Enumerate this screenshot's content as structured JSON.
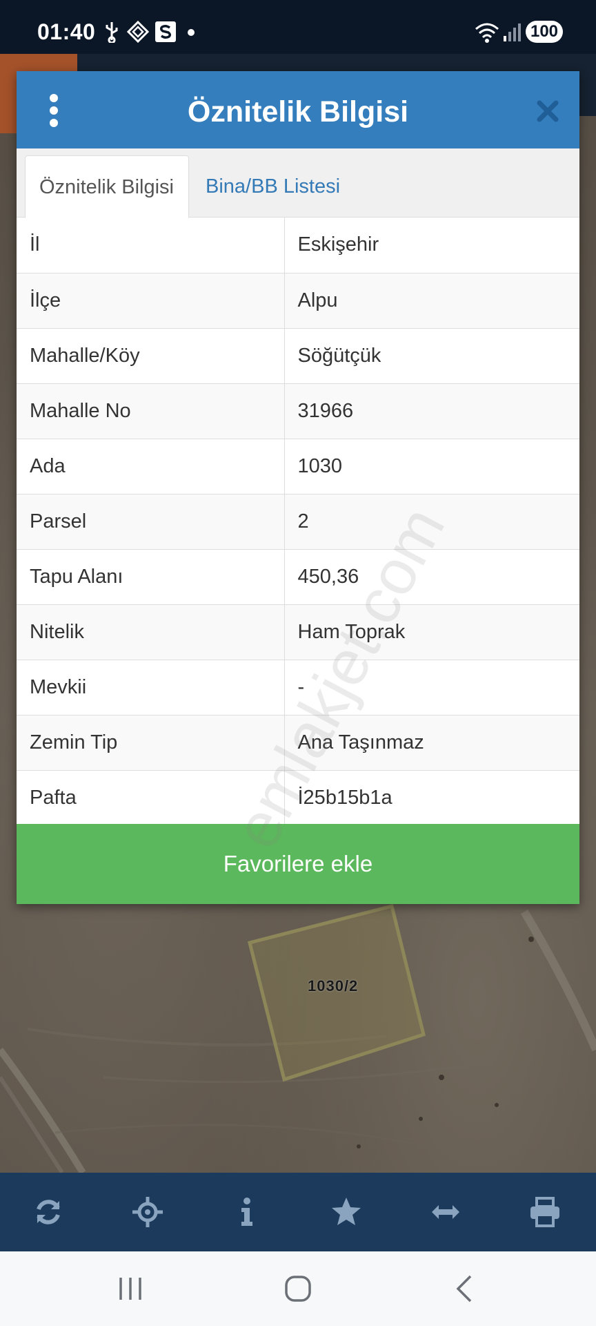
{
  "status_bar": {
    "time": "01:40",
    "battery": "100"
  },
  "dialog": {
    "title": "Öznitelik Bilgisi",
    "tabs": [
      {
        "label": "Öznitelik Bilgisi",
        "active": true
      },
      {
        "label": "Bina/BB Listesi",
        "active": false
      }
    ],
    "attributes": [
      {
        "key": "İl",
        "value": "Eskişehir"
      },
      {
        "key": "İlçe",
        "value": "Alpu"
      },
      {
        "key": "Mahalle/Köy",
        "value": "Söğütçük"
      },
      {
        "key": "Mahalle No",
        "value": "31966"
      },
      {
        "key": "Ada",
        "value": "1030"
      },
      {
        "key": "Parsel",
        "value": "2"
      },
      {
        "key": "Tapu Alanı",
        "value": "450,36"
      },
      {
        "key": "Nitelik",
        "value": "Ham Toprak"
      },
      {
        "key": "Mevkii",
        "value": "-"
      },
      {
        "key": "Zemin Tip",
        "value": "Ana Taşınmaz"
      },
      {
        "key": "Pafta",
        "value": "İ25b15b1a"
      }
    ],
    "favorite_button": "Favorilere ekle"
  },
  "watermark": "emlakjet.com",
  "map": {
    "parcel_label": "1030/2"
  },
  "toolbar": {
    "items": [
      "refresh-icon",
      "crosshair-icon",
      "info-icon",
      "star-icon",
      "arrows-horizontal-icon",
      "print-icon"
    ]
  },
  "colors": {
    "header_blue": "#357ebd",
    "link_blue": "#337ab7",
    "button_green": "#5cb85c",
    "toolbar_navy": "#1c3b5c",
    "status_bar": "#0b1727"
  }
}
